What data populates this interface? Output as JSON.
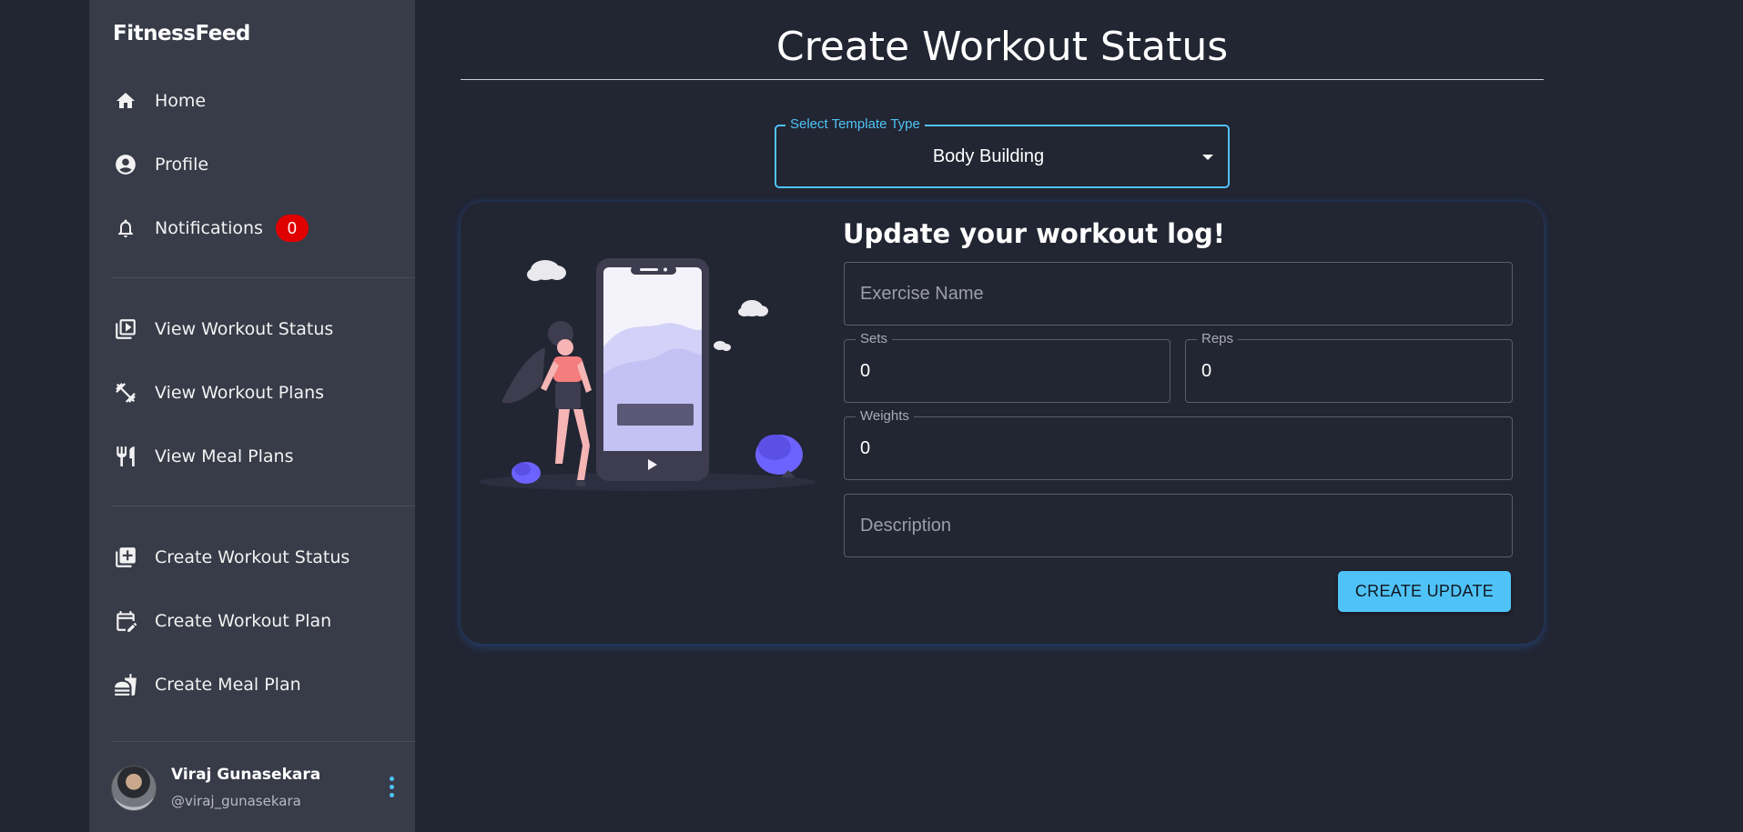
{
  "brand": "FitnessFeed",
  "nav": {
    "home": "Home",
    "profile": "Profile",
    "notifications": "Notifications",
    "notifications_count": "0",
    "view_workout_status": "View Workout Status",
    "view_workout_plans": "View Workout Plans",
    "view_meal_plans": "View Meal Plans",
    "create_workout_status": "Create Workout Status",
    "create_workout_plan": "Create Workout Plan",
    "create_meal_plan": "Create Meal Plan"
  },
  "icons": {
    "home": "home-icon",
    "profile": "account-circle-icon",
    "notifications": "bell-icon",
    "view_workout_status": "video-library-icon",
    "view_workout_plans": "dumbbell-icon",
    "view_meal_plans": "utensils-icon",
    "create_workout_status": "add-box-icon",
    "create_workout_plan": "calendar-edit-icon",
    "create_meal_plan": "fastfood-icon",
    "more": "kebab-menu-icon"
  },
  "user": {
    "name": "Viraj Gunasekara",
    "handle": "@viraj_gunasekara"
  },
  "page": {
    "title": "Create Workout Status"
  },
  "template_select": {
    "label": "Select Template Type",
    "value": "Body Building"
  },
  "form": {
    "heading": "Update your workout log!",
    "exercise_name_placeholder": "Exercise Name",
    "sets_label": "Sets",
    "sets_value": "0",
    "reps_label": "Reps",
    "reps_value": "0",
    "weights_label": "Weights",
    "weights_value": "0",
    "description_placeholder": "Description",
    "submit_label": "CREATE UPDATE"
  },
  "colors": {
    "background": "#222532",
    "sidebar": "#383b48",
    "accent": "#4fc3f7",
    "badge": "#e00000",
    "illustration_purple": "#6c63ff"
  }
}
